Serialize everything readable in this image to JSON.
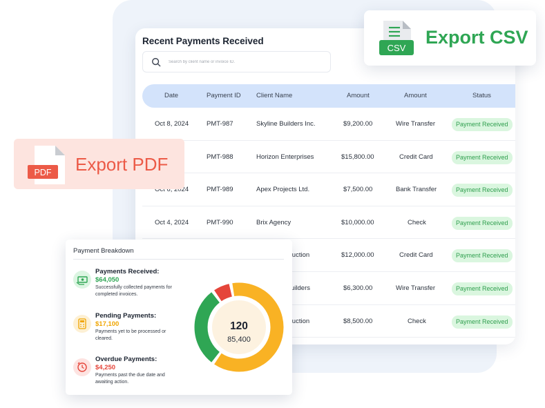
{
  "table": {
    "title": "Recent Payments Received",
    "search_placeholder": "Search by client name or invoice ID.",
    "headers": [
      "Date",
      "Payment ID",
      "Client Name",
      "Amount",
      "Amount",
      "Status"
    ],
    "rows": [
      {
        "date": "Oct 8, 2024",
        "id": "PMT-987",
        "client": "Skyline Builders Inc.",
        "amount": "$9,200.00",
        "method": "Wire Transfer",
        "status": "Payment Received"
      },
      {
        "date": "",
        "id": "PMT-988",
        "client": "Horizon Enterprises",
        "amount": "$15,800.00",
        "method": "Credit Card",
        "status": "Payment Received"
      },
      {
        "date": "Oct 6, 2024",
        "id": "PMT-989",
        "client": "Apex Projects Ltd.",
        "amount": "$7,500.00",
        "method": "Bank Transfer",
        "status": "Payment Received"
      },
      {
        "date": "Oct 4, 2024",
        "id": "PMT-990",
        "client": "Brix Agency",
        "amount": "$10,000.00",
        "method": "Check",
        "status": "Payment Received"
      },
      {
        "date": "",
        "id": "",
        "client": "truction",
        "amount": "$12,000.00",
        "method": "Credit Card",
        "status": "Payment Received"
      },
      {
        "date": "",
        "id": "",
        "client": "uilders",
        "amount": "$6,300.00",
        "method": "Wire Transfer",
        "status": "Payment Received"
      },
      {
        "date": "",
        "id": "",
        "client": "truction",
        "amount": "$8,500.00",
        "method": "Check",
        "status": "Payment Received"
      }
    ]
  },
  "export_csv": {
    "label": "Export CSV",
    "icon_text": "CSV",
    "icon": "csv-file-icon",
    "color": "#2fa654"
  },
  "export_pdf": {
    "label": "Export PDF",
    "icon_text": "PDF",
    "icon": "pdf-file-icon",
    "color": "#ec5a47"
  },
  "breakdown": {
    "title": "Payment Breakdown",
    "items": [
      {
        "title": "Payments Received:",
        "amount": "$64,050",
        "amount_color": "#2fa654",
        "desc": "Successfully collected payments for completed invoices.",
        "icon": "money-icon",
        "icon_bg": "#dcf5e2"
      },
      {
        "title": "Pending Payments:",
        "amount": "$17,100",
        "amount_color": "#f0a500",
        "desc": "Payments yet to be processed or cleared.",
        "icon": "calculator-icon",
        "icon_bg": "#fdf0d4"
      },
      {
        "title": "Overdue Payments:",
        "amount": "$4,250",
        "amount_color": "#e5453a",
        "desc": "Payments past the due date and awaiting action.",
        "icon": "clock-alert-icon",
        "icon_bg": "#fde3e1"
      }
    ],
    "donut": {
      "count": "120",
      "total": "85,400",
      "segments": [
        {
          "name": "received",
          "value": 0.3,
          "color": "#2fa654"
        },
        {
          "name": "overdue",
          "value": 0.07,
          "color": "#e5453a"
        },
        {
          "name": "pending",
          "value": 0.63,
          "color": "#f9b224"
        }
      ]
    }
  }
}
